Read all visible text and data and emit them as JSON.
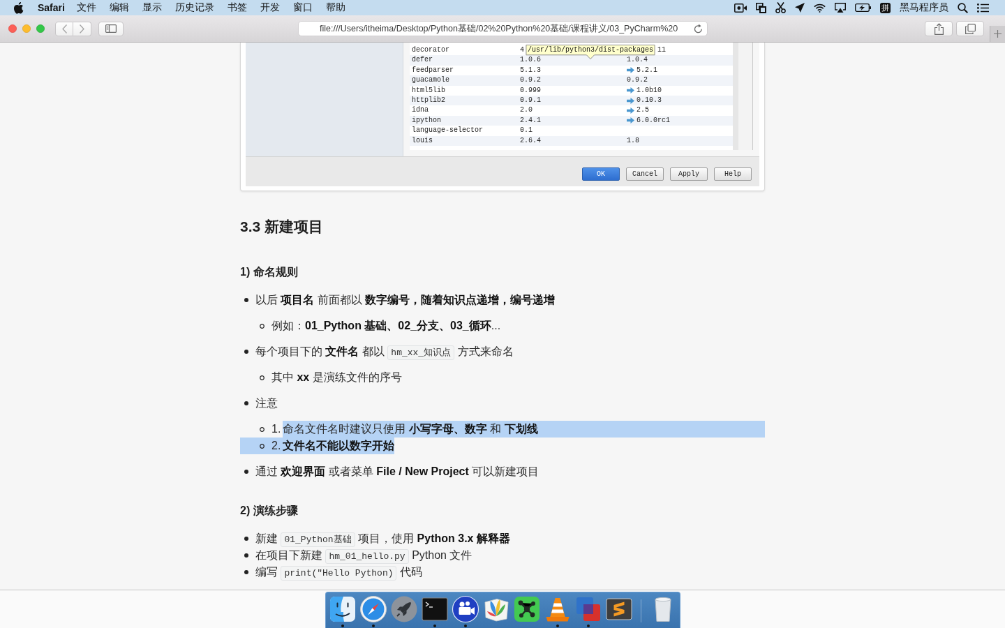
{
  "menu_bar": {
    "app_menu": "Safari",
    "menus": [
      "文件",
      "编辑",
      "显示",
      "历史记录",
      "书签",
      "开发",
      "窗口",
      "帮助"
    ],
    "status_items": [
      {
        "kind": "record"
      },
      {
        "kind": "screens"
      },
      {
        "kind": "scissors"
      },
      {
        "kind": "plane"
      },
      {
        "kind": "wifi"
      },
      {
        "kind": "airplay"
      },
      {
        "kind": "battery"
      },
      {
        "kind": "input",
        "text": "拼"
      },
      {
        "kind": "label",
        "text": "黑马程序员"
      },
      {
        "kind": "search"
      },
      {
        "kind": "list"
      }
    ]
  },
  "toolbar": {
    "url": "file:///Users/itheima/Desktop/Python基础/02%20Python%20基础/课程讲义/03_PyCharm%20"
  },
  "dialog": {
    "rows": [
      {
        "column_1": "decorator",
        "column_2": "4",
        "column_3": "11",
        "upgrade_arrow": false,
        "tooltip": "/usr/lib/python3/dist-packages"
      },
      {
        "column_1": "defer",
        "column_2": "1.0.6",
        "column_3": "1.0.4",
        "upgrade_arrow": false
      },
      {
        "column_1": "feedparser",
        "column_2": "5.1.3",
        "column_3": "5.2.1",
        "upgrade_arrow": true
      },
      {
        "column_1": "guacamole",
        "column_2": "0.9.2",
        "column_3": "0.9.2",
        "upgrade_arrow": false
      },
      {
        "column_1": "html5lib",
        "column_2": "0.999",
        "column_3": "1.0b10",
        "upgrade_arrow": true
      },
      {
        "column_1": "httplib2",
        "column_2": "0.9.1",
        "column_3": "0.10.3",
        "upgrade_arrow": true
      },
      {
        "column_1": "idna",
        "column_2": "2.0",
        "column_3": "2.5",
        "upgrade_arrow": true
      },
      {
        "column_1": "ipython",
        "column_2": "2.4.1",
        "column_3": "6.0.0rc1",
        "upgrade_arrow": true
      },
      {
        "column_1": "language-selector",
        "column_2": "0.1",
        "upgrade_arrow": false
      },
      {
        "column_1": "louis",
        "column_2": "2.6.4",
        "column_3": "1.8",
        "upgrade_arrow": false
      }
    ],
    "buttons": [
      {
        "label": "OK",
        "default": true
      },
      {
        "label": "Cancel",
        "default": false
      },
      {
        "label": "Apply",
        "default": false
      },
      {
        "label": "Help",
        "default": false
      }
    ]
  },
  "article": {
    "heading": "3.3 新建项目",
    "sections": [
      {
        "heading": "1) 命名规则",
        "items": [
          {
            "selected": false,
            "parts": [
              {
                "kind": "text",
                "text": "以后 **项目名** 前面都以 **数字编号，随着知识点递增，编号递增**"
              }
            ],
            "children": [
              {
                "selected": false,
                "parts": [
                  {
                    "kind": "text",
                    "text": "例如：**01_Python 基础、02_分支、03_循环**..."
                  }
                ]
              }
            ]
          },
          {
            "selected": false,
            "parts": [
              {
                "kind": "text",
                "text": "每个项目下的 **文件名** 都以"
              },
              {
                "kind": "code",
                "text": "hm_xx_知识点"
              },
              {
                "kind": "text",
                "text": "方式来命名"
              }
            ],
            "children": [
              {
                "selected": false,
                "parts": [
                  {
                    "kind": "text",
                    "text": "其中 **xx** 是演练文件的序号"
                  }
                ]
              }
            ]
          },
          {
            "selected": false,
            "parts": [
              {
                "kind": "text",
                "text": "注意"
              }
            ],
            "children": [
              {
                "selected": true,
                "number": "1.",
                "parts": [
                  {
                    "kind": "text",
                    "text": "命名文件名时建议只使用 **小写字母、数字** 和 **下划线**"
                  }
                ]
              },
              {
                "selected": true,
                "number": "2.",
                "parts": [
                  {
                    "kind": "text",
                    "text": "**文件名不能以数字开始**"
                  }
                ]
              }
            ]
          },
          {
            "selected": false,
            "parts": [
              {
                "kind": "text",
                "text": "通过 **欢迎界面** 或者菜单 **File / New Project** 可以新建项目"
              }
            ]
          }
        ]
      },
      {
        "heading": "2) 演练步骤",
        "items": [
          {
            "selected": false,
            "parts": [
              {
                "kind": "text",
                "text": "新建"
              },
              {
                "kind": "code",
                "text": "01_Python基础"
              },
              {
                "kind": "text",
                "text": "项目，使用 **Python 3.x 解释器**"
              }
            ]
          },
          {
            "selected": false,
            "parts": [
              {
                "kind": "text",
                "text": "在项目下新建"
              },
              {
                "kind": "code",
                "text": "hm_01_hello.py"
              },
              {
                "kind": "text",
                "text": "Python 文件"
              }
            ]
          },
          {
            "selected": false,
            "parts": [
              {
                "kind": "text",
                "text": "编写"
              },
              {
                "kind": "code",
                "text": "print(\"Hello Python)"
              },
              {
                "kind": "text",
                "text": "代码"
              }
            ]
          }
        ]
      }
    ]
  },
  "dock": {
    "items": [
      {
        "kind": "face",
        "running": true
      },
      {
        "kind": "compass",
        "running": true
      },
      {
        "kind": "rocket",
        "running": false
      },
      {
        "kind": "terminal",
        "running": true
      },
      {
        "kind": "camera",
        "running": true
      },
      {
        "kind": "book",
        "running": false
      },
      {
        "kind": "network",
        "running": false
      },
      {
        "kind": "cone",
        "running": true
      },
      {
        "kind": "squares",
        "running": true
      },
      {
        "kind": "bands",
        "running": false
      },
      {
        "kind": "trash",
        "running": false
      }
    ]
  }
}
